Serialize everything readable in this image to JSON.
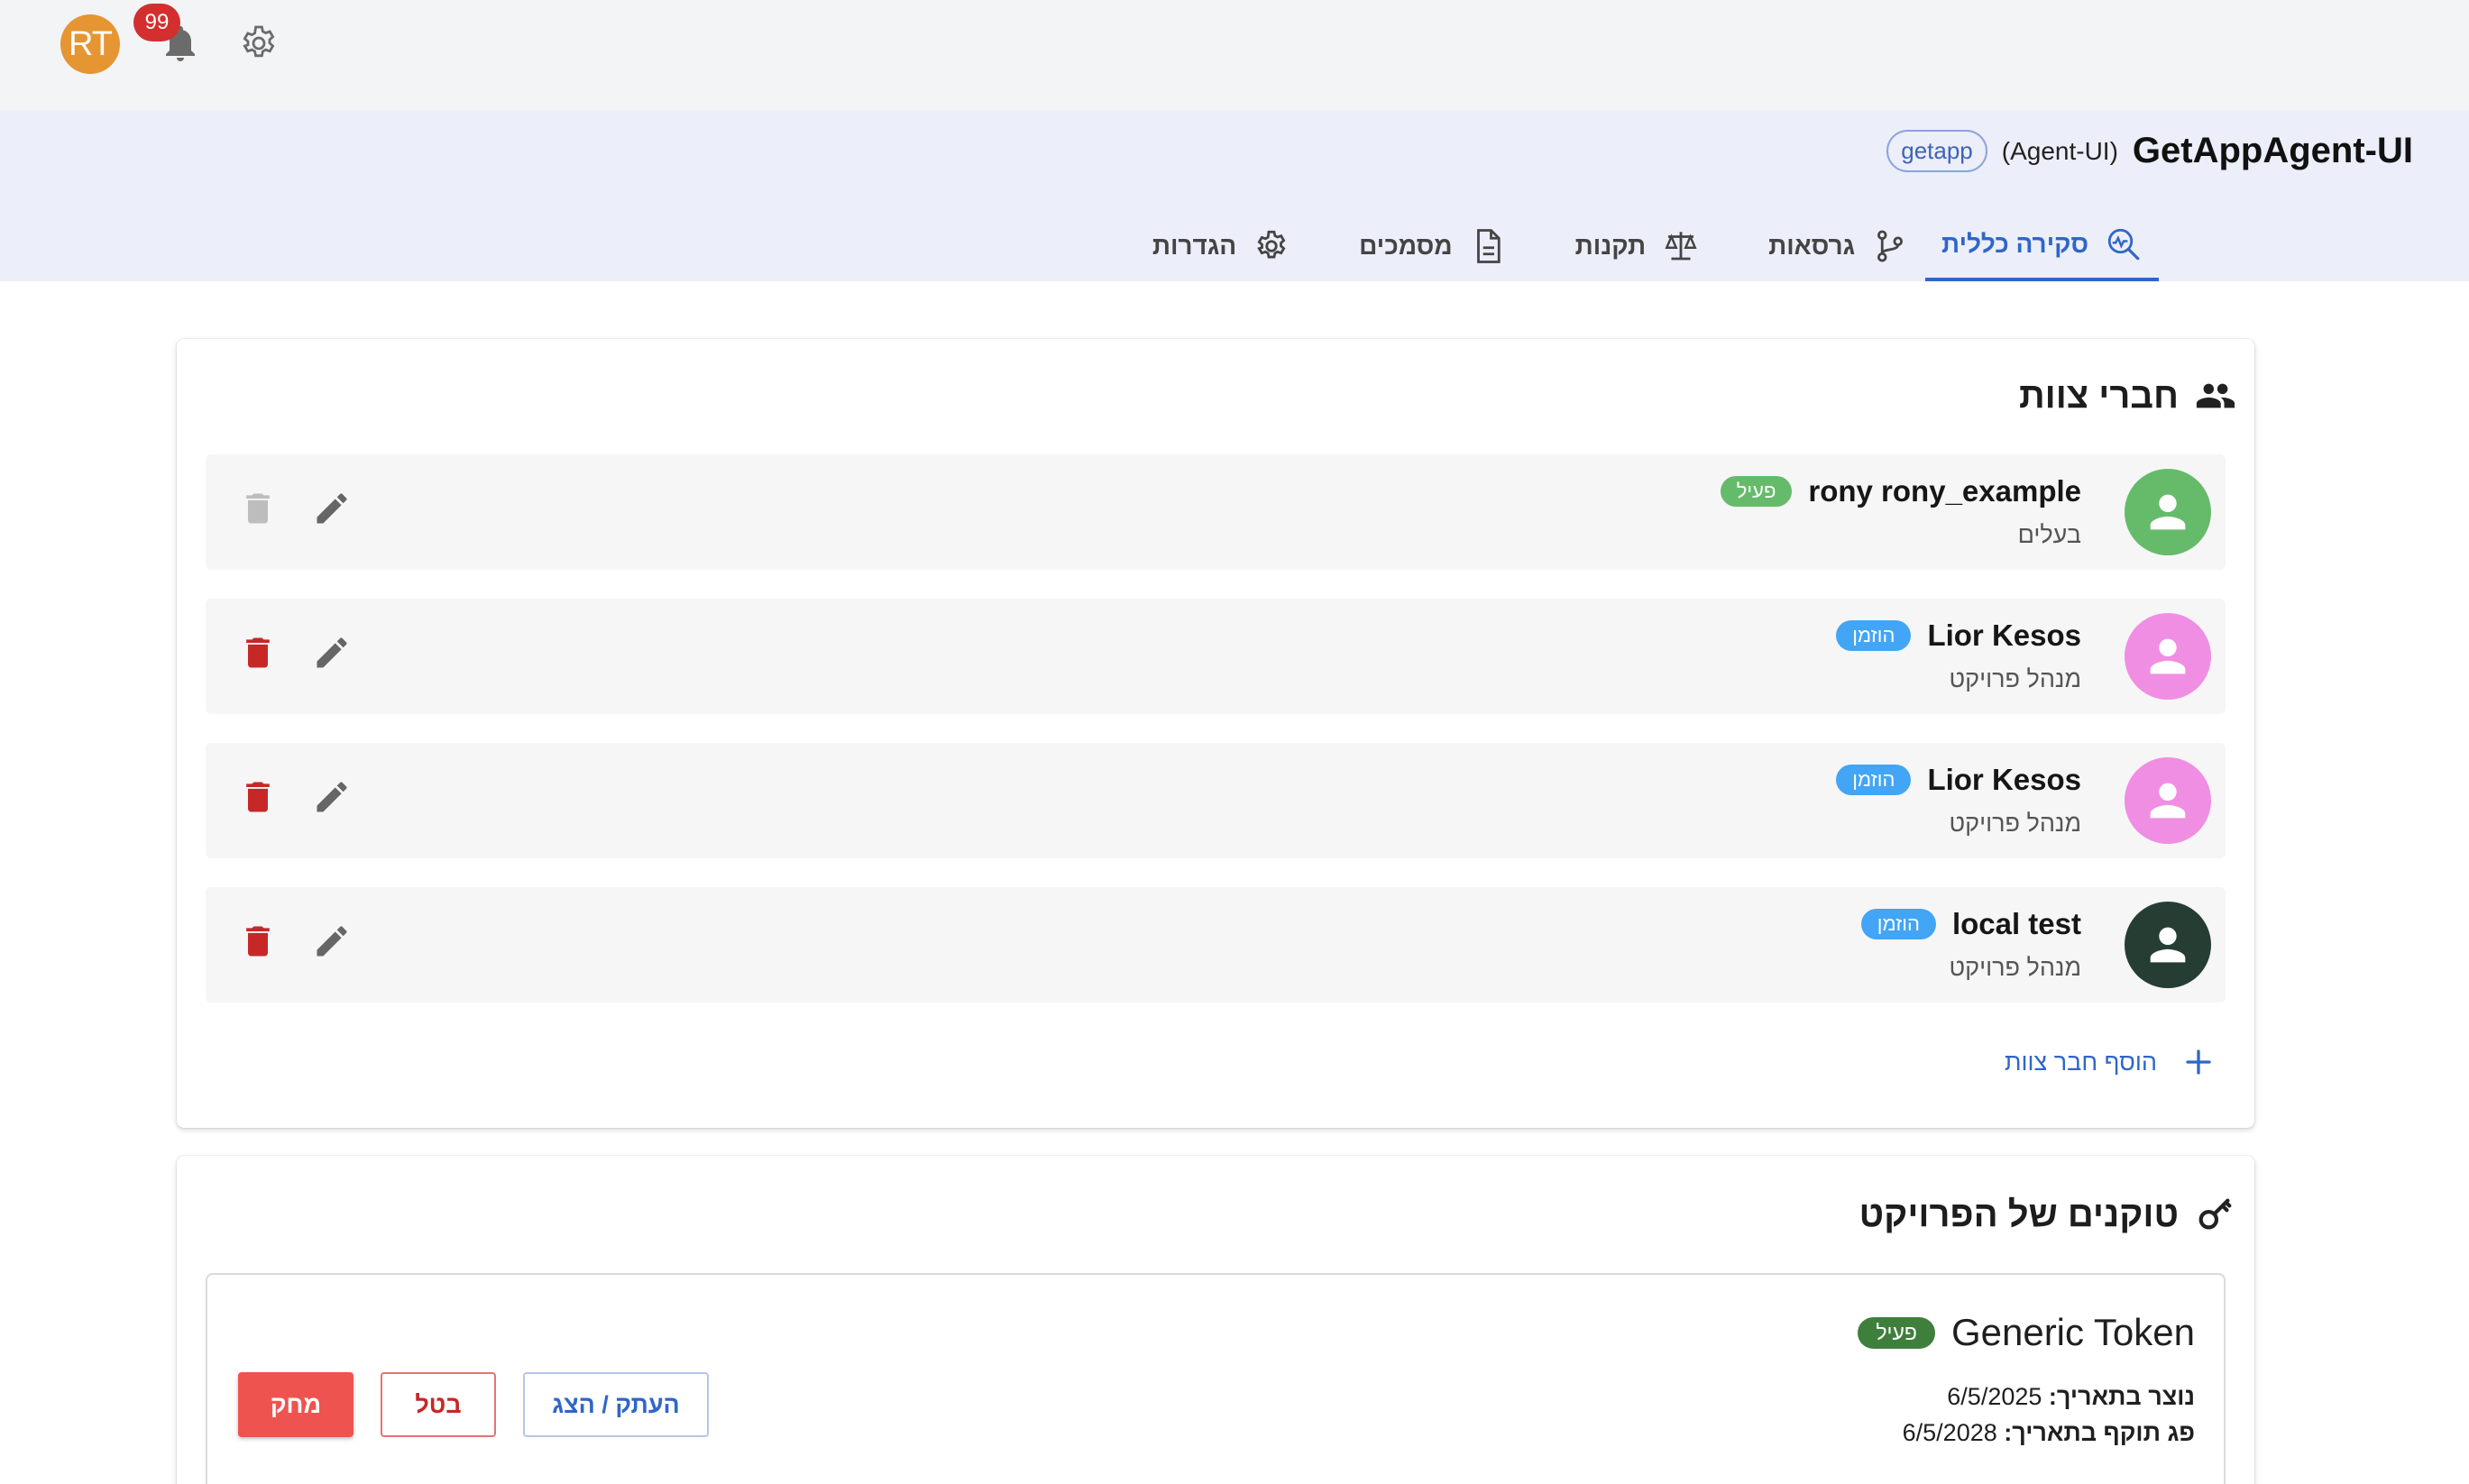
{
  "topbar": {
    "avatar_initials": "RT",
    "notifications_count": "99",
    "avatar_color": "#e69533"
  },
  "project": {
    "name": "GetAppAgent-UI",
    "subtitle": "(Agent-UI)",
    "chip": "getapp"
  },
  "tabs": [
    {
      "label": "סקירה כללית",
      "icon": "analytics-icon",
      "active": true
    },
    {
      "label": "גרסאות",
      "icon": "branch-icon",
      "active": false
    },
    {
      "label": "תקנות",
      "icon": "scale-icon",
      "active": false
    },
    {
      "label": "מסמכים",
      "icon": "document-icon",
      "active": false
    },
    {
      "label": "הגדרות",
      "icon": "gear-icon",
      "active": false
    }
  ],
  "team": {
    "title": "חברי צוות",
    "add_label": "הוסף חבר צוות",
    "members": [
      {
        "name": "rony rony_example",
        "status": "פעיל",
        "status_color": "#66bb6a",
        "role": "בעלים",
        "avatar_color": "#66bb6a",
        "delete_enabled": false
      },
      {
        "name": "Lior Kesos",
        "status": "הוזמן",
        "status_color": "#42a5f5",
        "role": "מנהל פרויקט",
        "avatar_color": "#f08ee3",
        "delete_enabled": true
      },
      {
        "name": "Lior Kesos",
        "status": "הוזמן",
        "status_color": "#42a5f5",
        "role": "מנהל פרויקט",
        "avatar_color": "#f08ee3",
        "delete_enabled": true
      },
      {
        "name": "local test",
        "status": "הוזמן",
        "status_color": "#42a5f5",
        "role": "מנהל פרויקט",
        "avatar_color": "#263d33",
        "delete_enabled": true
      }
    ]
  },
  "tokens": {
    "title": "טוקנים של הפרויקט",
    "items": [
      {
        "name": "Generic Token",
        "status": "פעיל",
        "created_label": "נוצר בתאריך:",
        "created_value": "6/5/2025",
        "expires_label": "פג תוקף בתאריך:",
        "expires_value": "6/5/2028",
        "copy_label": "העתק / הצג",
        "cancel_label": "בטל",
        "delete_label": "מחק"
      }
    ]
  },
  "colors": {
    "accent": "#2f66c8",
    "danger": "#d32f2f",
    "header_bg": "#eceef9"
  }
}
